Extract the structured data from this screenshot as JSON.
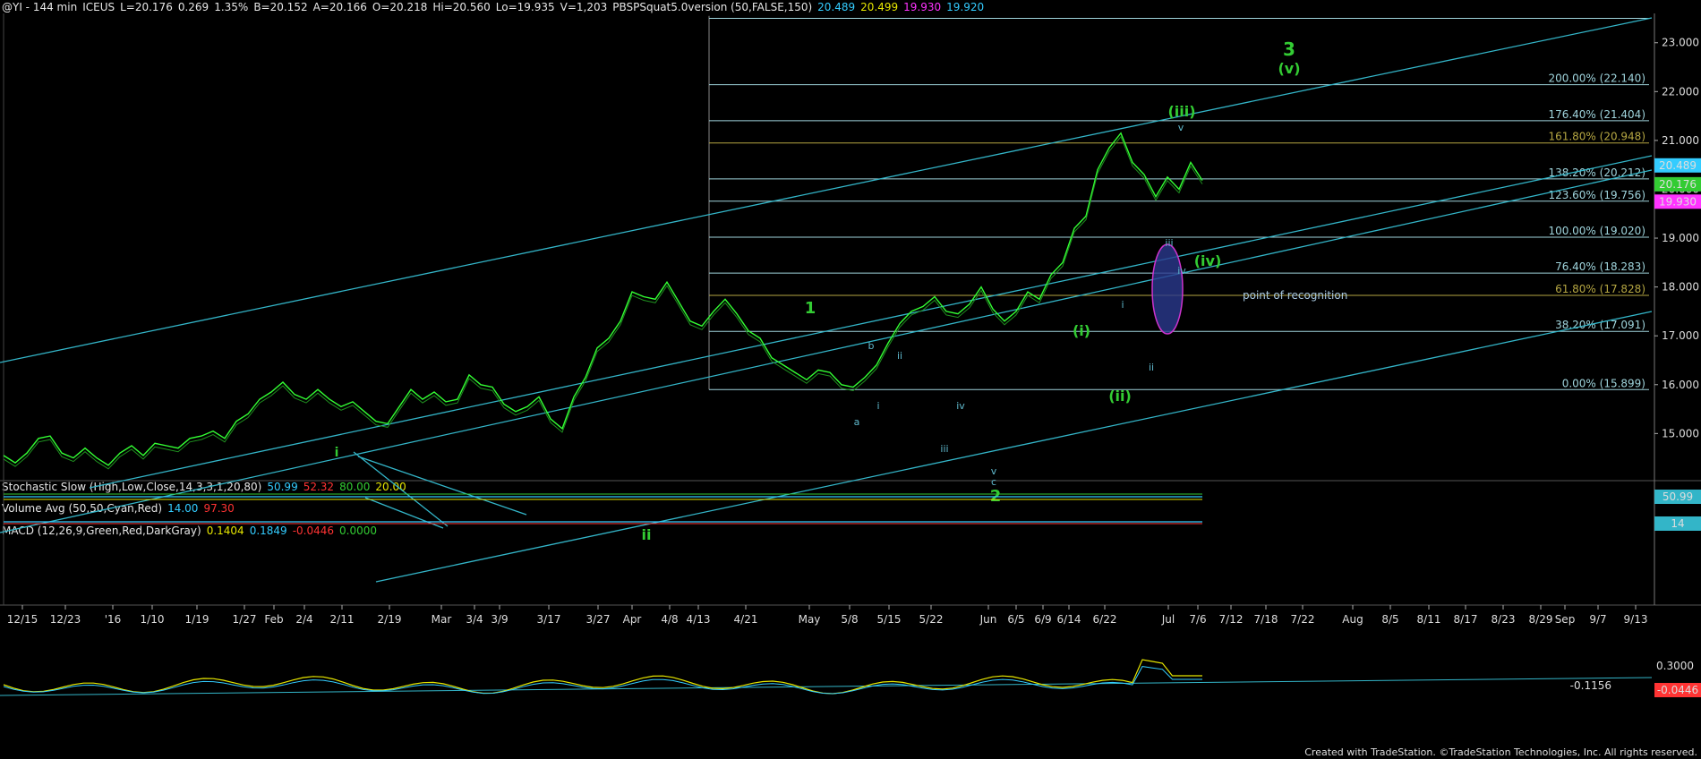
{
  "header": {
    "symbol": "@YI - 144 min",
    "exchange": "ICEUS",
    "last": "L=20.176",
    "change": "0.269",
    "change_pct": "1.35%",
    "bid": "B=20.152",
    "ask": "A=20.166",
    "open": "O=20.218",
    "high": "Hi=20.560",
    "low": "Lo=19.935",
    "volume": "V=1,203",
    "study_name": "PBSPSquat5.0version (50,FALSE,150)",
    "study_values": [
      "20.489",
      "20.499",
      "19.930",
      "19.920"
    ],
    "study_colors": [
      "#33ccff",
      "#e6e600",
      "#ff33ff",
      "#33ccff"
    ]
  },
  "indicators": {
    "stochastic": {
      "name": "Stochastic Slow (High,Low,Close,14,3,3,1,20,80)",
      "values": [
        "50.99",
        "52.32",
        "80.00",
        "20.00"
      ],
      "colors": [
        "#33ccff",
        "#ff3333",
        "#33cc33",
        "#e6e600"
      ],
      "axis_box": "50.99"
    },
    "volume": {
      "name": "Volume Avg (50,50,Cyan,Red)",
      "values": [
        "14.00",
        "97.30"
      ],
      "colors": [
        "#33ccff",
        "#ff3333"
      ],
      "axis_box": "14"
    },
    "macd": {
      "name": "MACD (12,26,9,Green,Red,DarkGray)",
      "values": [
        "0.1404",
        "0.1849",
        "-0.0446",
        "0.0000"
      ],
      "colors": [
        "#e6e600",
        "#33ccff",
        "#ff3333",
        "#33cc33"
      ],
      "axis_label": "0.3000",
      "axis_box": "-0.0446",
      "trend_label": "-0.1156"
    }
  },
  "colors": {
    "background": "#000000",
    "price": "#33ff33",
    "channel": "#33b5c8",
    "wave_green": "#33cc33",
    "wave_cyan": "#5fb8cc",
    "fib": "#9fd4dc",
    "fib_gold": "#b5a642",
    "last_box": "#33cc33",
    "high_box": "#33ccff",
    "low_box": "#ff33ff"
  },
  "chart_data": {
    "type": "line",
    "title": "@YI - 144 min",
    "y_ticks": [
      "23.000",
      "22.000",
      "21.000",
      "20.000",
      "19.000",
      "18.000",
      "17.000",
      "16.000",
      "15.000"
    ],
    "ylim": [
      14.2,
      23.6
    ],
    "x_ticks": [
      "12/15",
      "12/23",
      "'16",
      "1/10",
      "1/19",
      "1/27",
      "Feb",
      "2/4",
      "2/11",
      "2/19",
      "Mar",
      "3/4",
      "3/9",
      "3/17",
      "3/27",
      "Apr",
      "4/8",
      "4/13",
      "4/21",
      "May",
      "5/8",
      "5/15",
      "5/22",
      "Jun",
      "6/5",
      "6/9",
      "6/14",
      "6/22",
      "Jul",
      "7/6",
      "7/12",
      "7/18",
      "7/22",
      "Aug",
      "8/5",
      "8/11",
      "8/17",
      "8/23",
      "8/29",
      "Sep",
      "9/7",
      "9/13"
    ],
    "price_boxes": [
      "20.489",
      "20.176",
      "19.930"
    ],
    "series": [
      {
        "values": [
          14.55,
          14.4,
          14.6,
          14.9,
          14.95,
          14.6,
          14.5,
          14.7,
          14.5,
          14.35,
          14.6,
          14.75,
          14.55,
          14.8,
          14.75,
          14.7,
          14.9,
          14.95,
          15.05,
          14.9,
          15.25,
          15.4,
          15.7,
          15.85,
          16.05,
          15.8,
          15.7,
          15.9,
          15.7,
          15.55,
          15.65,
          15.45,
          15.25,
          15.2,
          15.55,
          15.9,
          15.7,
          15.85,
          15.65,
          15.7,
          16.2,
          16.0,
          15.95,
          15.6,
          15.45,
          15.55,
          15.75,
          15.3,
          15.1,
          15.75,
          16.15,
          16.75,
          16.95,
          17.3,
          17.9,
          17.8,
          17.75,
          18.1,
          17.7,
          17.3,
          17.2,
          17.5,
          17.75,
          17.45,
          17.1,
          16.95,
          16.55,
          16.4,
          16.25,
          16.1,
          16.3,
          16.25,
          16.0,
          15.95,
          16.15,
          16.4,
          16.85,
          17.25,
          17.5,
          17.6,
          17.8,
          17.5,
          17.45,
          17.65,
          18.0,
          17.55,
          17.3,
          17.5,
          17.9,
          17.75,
          18.25,
          18.5,
          19.2,
          19.45,
          20.4,
          20.85,
          21.15,
          20.55,
          20.3,
          19.85,
          20.25,
          20.0,
          20.55,
          20.18
        ]
      }
    ],
    "fib_levels": [
      {
        "label": "200.00% (22.140)",
        "value": 22.14
      },
      {
        "label": "176.40% (21.404)",
        "value": 21.404
      },
      {
        "label": "161.80% (20.948)",
        "value": 20.948
      },
      {
        "label": "138.20% (20.212)",
        "value": 20.212
      },
      {
        "label": "123.60% (19.756)",
        "value": 19.756
      },
      {
        "label": "100.00% (19.020)",
        "value": 19.02
      },
      {
        "label": "76.40% (18.283)",
        "value": 18.283
      },
      {
        "label": "61.80% (17.828)",
        "value": 17.828
      },
      {
        "label": "38.20% (17.091)",
        "value": 17.091
      },
      {
        "label": "0.00% (15.899)",
        "value": 15.899
      }
    ],
    "wave_labels": [
      "3",
      "(v)",
      "(iii)",
      "v",
      "iii",
      "(iv)",
      "iv",
      "point of recognition",
      "1",
      "i",
      "(i)",
      "ii",
      "(ii)",
      "b",
      "ii",
      "i",
      "a",
      "iv",
      "iii",
      "v",
      "c",
      "2",
      "i",
      "ii"
    ]
  },
  "footer": {
    "text": "Created with TradeStation. ©TradeStation Technologies, Inc. All rights reserved."
  }
}
